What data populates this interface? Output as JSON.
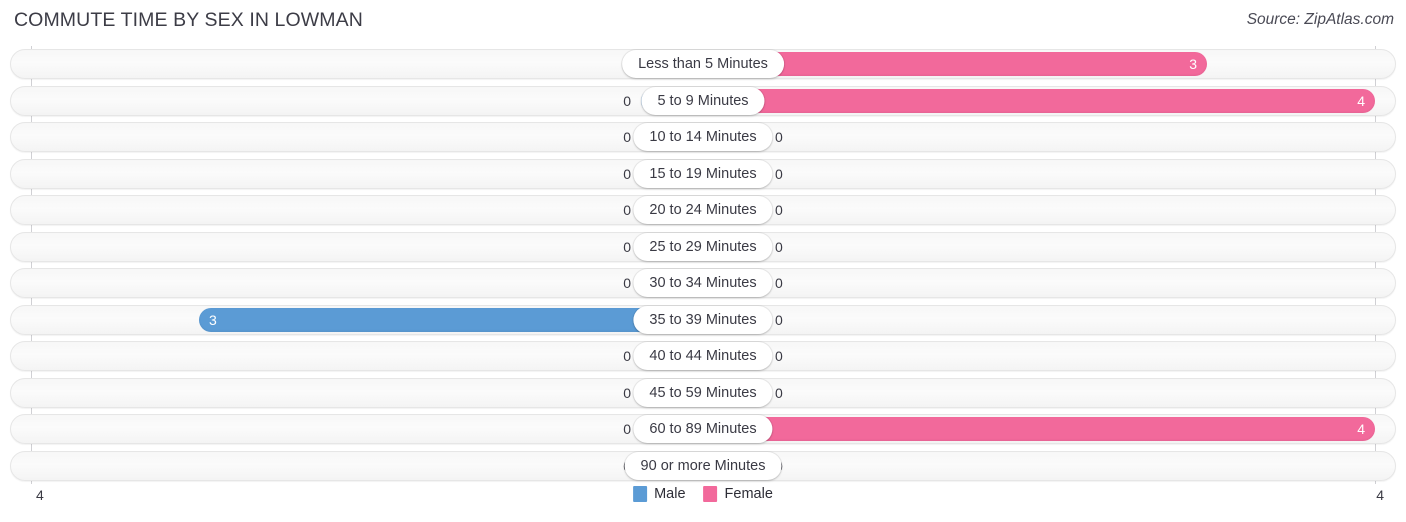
{
  "header": {
    "title": "COMMUTE TIME BY SEX IN LOWMAN",
    "source": "Source: ZipAtlas.com"
  },
  "legend": {
    "items": [
      {
        "label": "Male",
        "color": "#5b9bd5"
      },
      {
        "label": "Female",
        "color": "#f2699b"
      }
    ]
  },
  "axis": {
    "left_tick": "4",
    "right_tick": "4"
  },
  "colors": {
    "male": "#5b9bd5",
    "male_zero": "#a8c8e8",
    "female": "#f2699b",
    "female_zero": "#f9a7c5",
    "track": "#f7f7f7",
    "axis_line": "#d0d0d4",
    "text": "#3a3a44"
  },
  "chart_data": {
    "type": "bar",
    "orientation": "horizontal",
    "layout": "diverging-pyramid",
    "title": "COMMUTE TIME BY SEX IN LOWMAN",
    "xlabel": "",
    "ylabel": "",
    "xlim": [
      -4,
      4
    ],
    "axis_ticks": [
      "4",
      "4"
    ],
    "grid": false,
    "legend_position": "bottom-center",
    "categories": [
      "Less than 5 Minutes",
      "5 to 9 Minutes",
      "10 to 14 Minutes",
      "15 to 19 Minutes",
      "20 to 24 Minutes",
      "25 to 29 Minutes",
      "30 to 34 Minutes",
      "35 to 39 Minutes",
      "40 to 44 Minutes",
      "45 to 59 Minutes",
      "60 to 89 Minutes",
      "90 or more Minutes"
    ],
    "series": [
      {
        "name": "Male",
        "side": "left",
        "color": "#5b9bd5",
        "values": [
          0,
          0,
          0,
          0,
          0,
          0,
          0,
          3,
          0,
          0,
          0,
          0
        ],
        "labels": [
          "0",
          "0",
          "0",
          "0",
          "0",
          "0",
          "0",
          "3",
          "0",
          "0",
          "0",
          "0"
        ]
      },
      {
        "name": "Female",
        "side": "right",
        "color": "#f2699b",
        "values": [
          3,
          4,
          0,
          0,
          0,
          0,
          0,
          0,
          0,
          0,
          4,
          0
        ],
        "labels": [
          "3",
          "4",
          "0",
          "0",
          "0",
          "0",
          "0",
          "0",
          "0",
          "0",
          "4",
          "0"
        ]
      }
    ]
  }
}
